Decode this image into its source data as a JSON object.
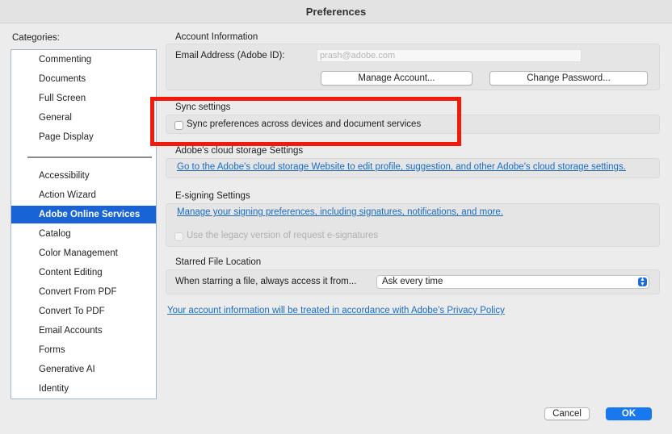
{
  "window": {
    "title": "Preferences"
  },
  "categories": {
    "label": "Categories:",
    "group1": [
      "Commenting",
      "Documents",
      "Full Screen",
      "General",
      "Page Display"
    ],
    "group2": [
      "Accessibility",
      "Action Wizard",
      "Adobe Online Services",
      "Catalog",
      "Color Management",
      "Content Editing",
      "Convert From PDF",
      "Convert To PDF",
      "Email Accounts",
      "Forms",
      "Generative AI",
      "Identity"
    ],
    "selected": "Adobe Online Services"
  },
  "account": {
    "title": "Account Information",
    "email_label": "Email Address (Adobe ID):",
    "email_value": "prash@adobe.com",
    "manage_button": "Manage Account...",
    "password_button": "Change Password..."
  },
  "sync": {
    "title": "Sync settings",
    "checkbox_label": "Sync preferences across devices and document services",
    "checked": false
  },
  "cloud": {
    "title": "Adobe's cloud storage Settings",
    "link": "Go to the Adobe's cloud storage Website to edit profile, suggestion, and other Adobe's cloud storage settings."
  },
  "esign": {
    "title": "E-signing Settings",
    "link": "Manage your signing preferences, including signatures, notifications, and more.",
    "legacy_label": "Use the legacy version of request e-signatures"
  },
  "starred": {
    "title": "Starred File Location",
    "label": "When starring a file, always access it from...",
    "selected_option": "Ask every time"
  },
  "privacy_link": "Your account information will be treated in accordance with Adobe's Privacy Policy",
  "footer": {
    "cancel": "Cancel",
    "ok": "OK"
  },
  "colors": {
    "selection": "#1863d6",
    "link": "#1a6bc4",
    "highlight": "#f21a0a",
    "primary_button": "#1878f0"
  }
}
